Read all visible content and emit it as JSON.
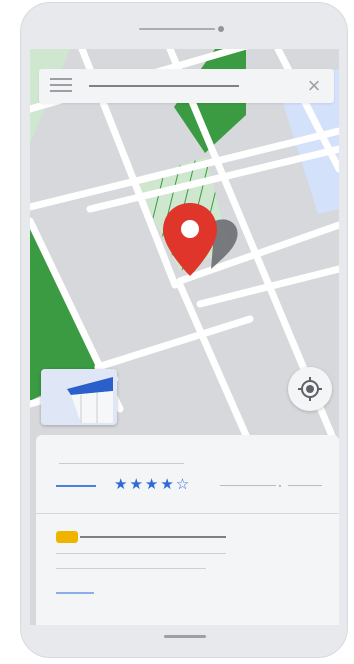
{
  "app": {
    "type": "map-app-illustration"
  },
  "search": {
    "menu_icon": "hamburger-menu-icon",
    "close_icon": "close-icon",
    "close_glyph": "×"
  },
  "map": {
    "pin_icon": "location-pin-icon",
    "colors": {
      "road": "#ffffff",
      "block": "#d7d8db",
      "park": "#3a9b43",
      "park_light": "#cfe7cf",
      "water": "#d4e1fb",
      "pin": "#e0352b"
    }
  },
  "controls": {
    "layers_icon": "layers-icon",
    "locate_icon": "my-location-icon"
  },
  "place_sheet": {
    "rating": 4,
    "rating_max": 5,
    "stars_text": "★★★★☆",
    "badge_color": "#f0b400"
  }
}
